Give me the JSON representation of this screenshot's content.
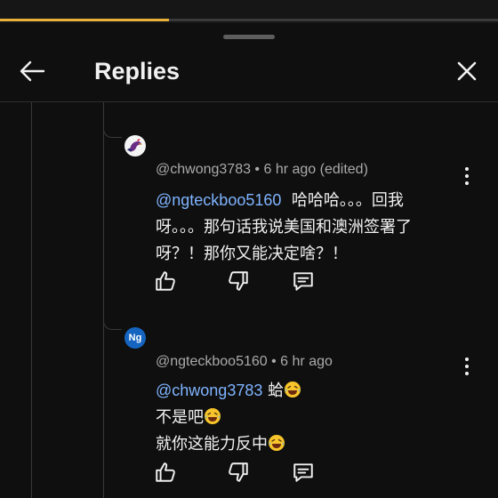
{
  "header": {
    "title": "Replies"
  },
  "comments": [
    {
      "handle": "@chwong3783",
      "time": "6 hr ago (edited)",
      "mention": "@ngteckboo5160",
      "line1_rest": "哈哈哈。。。回我",
      "line2": "呀。。。那句话我说美国和澳洲签署了",
      "line3": "呀？！那你又能决定啥？！"
    },
    {
      "handle": "@ngteckboo5160",
      "time": "6 hr ago",
      "avatar_initials": "Ng",
      "mention": "@chwong3783",
      "line1_rest": "蛤",
      "line2": "不是吧",
      "line3": "就你这能力反中"
    }
  ],
  "separator": " • ",
  "colors": {
    "accent": "#e8b23a",
    "mention": "#7fb4ff",
    "avatar_ng": "#1565c0"
  },
  "icons": [
    "back-arrow-icon",
    "close-icon",
    "like-icon",
    "dislike-icon",
    "reply-icon",
    "more-vert-icon",
    "laughing-emoji-icon"
  ]
}
